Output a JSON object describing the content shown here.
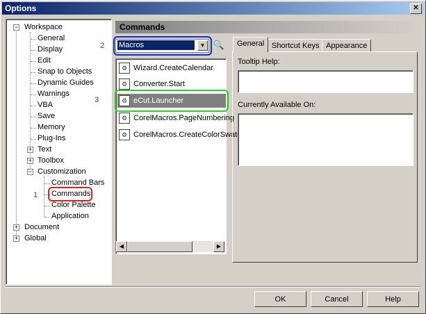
{
  "window": {
    "title": "Options",
    "close_glyph": "✕"
  },
  "tree": {
    "workspace": "Workspace",
    "items": [
      "General",
      "Display",
      "Edit",
      "Snap to Objects",
      "Dynamic Guides",
      "Warnings",
      "VBA",
      "Save",
      "Memory",
      "Plug-Ins"
    ],
    "text": "Text",
    "toolbox": "Toolbox",
    "customization": "Customization",
    "custom_items": [
      "Command Bars",
      "Commands",
      "Color Palette",
      "Application"
    ],
    "document": "Document",
    "global": "Global",
    "expand_glyph": "+",
    "collapse_glyph": "−"
  },
  "annotations": {
    "one": "1",
    "two": "2",
    "three": "3"
  },
  "header": {
    "title": "Commands"
  },
  "category_combo": {
    "value": "Macros",
    "arrow_glyph": "▼"
  },
  "find_icon": "🔍",
  "commands": [
    "Wizard.CreateCalendar",
    "Converter.Start",
    "eCut.Launcher",
    "CorelMacros.PageNumbering",
    "CorelMacros.CreateColorSwatch"
  ],
  "macro_icon_glyph": "⚙",
  "scroll": {
    "left": "◀",
    "right": "▶"
  },
  "tabs": [
    "General",
    "Shortcut Keys",
    "Appearance"
  ],
  "general_tab": {
    "tooltip_label": "Tooltip Help:",
    "available_label": "Currently Available On:"
  },
  "buttons": {
    "ok": "OK",
    "cancel": "Cancel",
    "help": "Help"
  },
  "colors": {
    "annotation_blue": "#1030d0",
    "annotation_red": "#e02020",
    "annotation_green": "#28d028",
    "selection": "#808080"
  }
}
